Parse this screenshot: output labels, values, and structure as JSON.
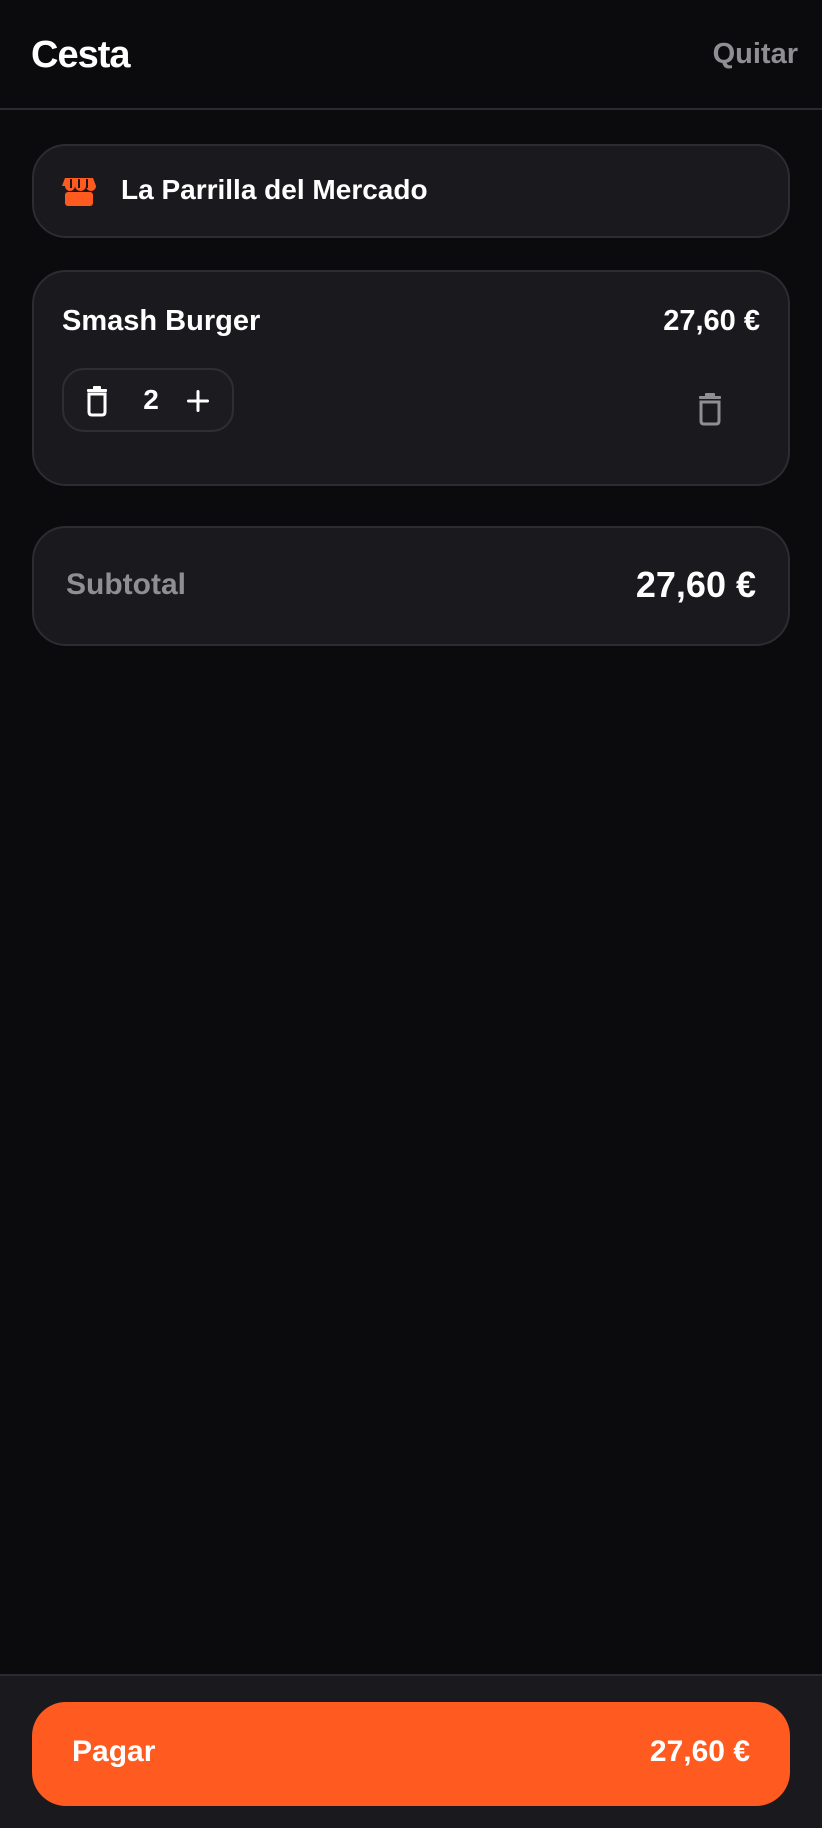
{
  "header": {
    "title": "Cesta",
    "quit_label": "Quitar"
  },
  "restaurant": {
    "name": "La Parrilla del Mercado",
    "icon": "store-icon"
  },
  "items": [
    {
      "name": "Smash Burger",
      "price": "27,60 €",
      "quantity": "2"
    }
  ],
  "summary": {
    "subtotal_label": "Subtotal",
    "subtotal_value": "27,60 €"
  },
  "checkout": {
    "pay_label": "Pagar",
    "pay_amount": "27,60 €"
  },
  "colors": {
    "accent": "#ff5a1f",
    "background": "#0b0b0d",
    "card": "#1a1a1e",
    "muted_text": "#8e8e93"
  }
}
